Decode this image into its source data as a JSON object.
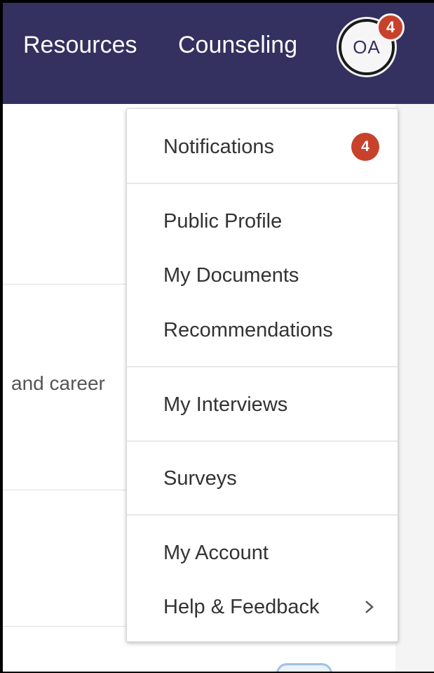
{
  "header": {
    "nav": [
      "Resources",
      "Counseling"
    ],
    "avatar_initials": "OA",
    "avatar_badge": "4"
  },
  "background": {
    "partial_text": "and career"
  },
  "dropdown": {
    "items": [
      {
        "label": "Notifications",
        "badge": "4"
      },
      {
        "label": "Public Profile"
      },
      {
        "label": "My Documents"
      },
      {
        "label": "Recommendations"
      },
      {
        "label": "My Interviews"
      },
      {
        "label": "Surveys"
      },
      {
        "label": "My Account"
      },
      {
        "label": "Help & Feedback"
      }
    ]
  },
  "colors": {
    "header_bg": "#34305f",
    "badge": "#c8412b"
  },
  "icons": {
    "submenu": "chevron-right-icon"
  }
}
